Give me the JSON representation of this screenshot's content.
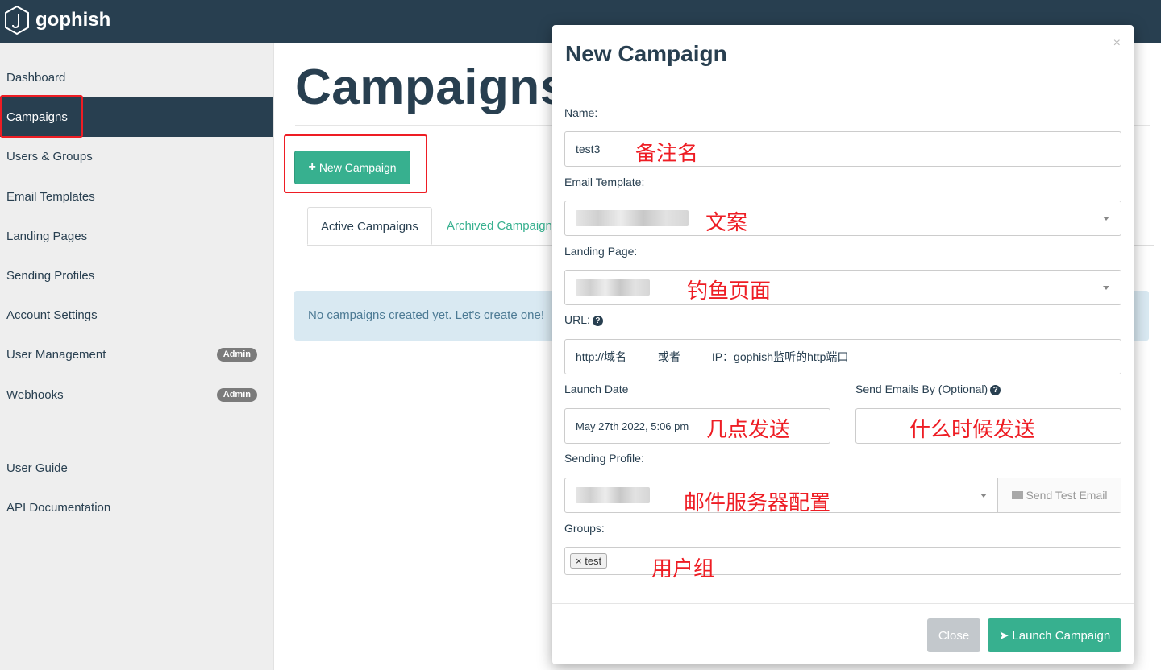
{
  "app": {
    "brand": "gophish"
  },
  "sidebar": {
    "items": [
      {
        "label": "Dashboard"
      },
      {
        "label": "Campaigns"
      },
      {
        "label": "Users & Groups"
      },
      {
        "label": "Email Templates"
      },
      {
        "label": "Landing Pages"
      },
      {
        "label": "Sending Profiles"
      },
      {
        "label": "Account Settings"
      },
      {
        "label": "User Management",
        "badge": "Admin"
      },
      {
        "label": "Webhooks",
        "badge": "Admin"
      }
    ],
    "footer_items": [
      {
        "label": "User Guide"
      },
      {
        "label": "API Documentation"
      }
    ]
  },
  "main": {
    "title": "Campaigns",
    "new_button": "New Campaign",
    "tabs": [
      {
        "label": "Active Campaigns"
      },
      {
        "label": "Archived Campaigns"
      }
    ],
    "empty_alert": "No campaigns created yet. Let's create one!"
  },
  "modal": {
    "title": "New Campaign",
    "close_glyph": "×",
    "name": {
      "label": "Name:",
      "value": "test3",
      "annotation": "备注名"
    },
    "email_template": {
      "label": "Email Template:",
      "annotation": "文案"
    },
    "landing_page": {
      "label": "Landing Page:",
      "annotation": "钓鱼页面"
    },
    "url": {
      "label": "URL:",
      "value": "http://域名          或者          IP：gophish监听的http端口"
    },
    "launch_date": {
      "label": "Launch Date",
      "value": "May 27th 2022, 5:06 pm",
      "annotation": "几点发送"
    },
    "send_by": {
      "label": "Send Emails By (Optional)",
      "annotation": "什么时候发送"
    },
    "sending_profile": {
      "label": "Sending Profile:",
      "annotation": "邮件服务器配置",
      "test_button": "Send Test Email"
    },
    "groups": {
      "label": "Groups:",
      "tag": "test",
      "annotation": "用户组"
    },
    "footer": {
      "close": "Close",
      "launch": "Launch Campaign"
    }
  },
  "colors": {
    "navbar": "#283f50",
    "accent": "#37b08f",
    "annotation": "#ee1d24",
    "alert_bg": "#d9e9f2"
  }
}
